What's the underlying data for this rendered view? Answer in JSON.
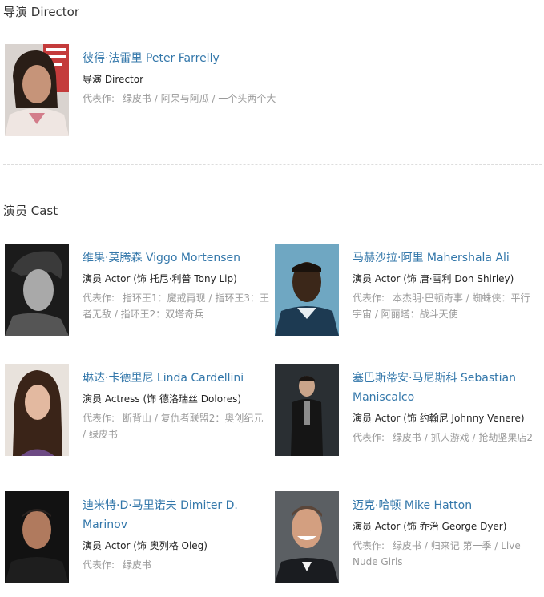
{
  "sections": {
    "director_title": "导演 Director",
    "cast_title": "演员 Cast"
  },
  "works_label": "代表作:",
  "director": {
    "name": "彼得·法雷里 Peter Farrelly",
    "role": "导演 Director",
    "works": "绿皮书 / 阿呆与阿瓜 / 一个头两个大"
  },
  "cast": [
    {
      "name": "维果·莫腾森 Viggo Mortensen",
      "role": "演员 Actor (饰 托尼·利普 Tony Lip)",
      "works": "指环王1：魔戒再现 / 指环王3：王者无敌 / 指环王2：双塔奇兵"
    },
    {
      "name": "马赫沙拉·阿里 Mahershala Ali",
      "role": "演员 Actor (饰 唐·雪利 Don Shirley)",
      "works": "本杰明·巴顿奇事 / 蜘蛛侠：平行宇宙 / 阿丽塔：战斗天使"
    },
    {
      "name": "琳达·卡德里尼 Linda Cardellini",
      "role": "演员 Actress (饰 德洛瑞丝 Dolores)",
      "works": "断背山 / 复仇者联盟2：奥创纪元 / 绿皮书"
    },
    {
      "name": "塞巴斯蒂安·马尼斯科 Sebastian Maniscalco",
      "role": "演员 Actor (饰 约翰尼 Johnny Venere)",
      "works": "绿皮书 / 抓人游戏 / 抢劫坚果店2"
    },
    {
      "name": "迪米特·D·马里诺夫 Dimiter D. Marinov",
      "role": "演员 Actor (饰 奥列格 Oleg)",
      "works": "绿皮书"
    },
    {
      "name": "迈克·哈顿 Mike Hatton",
      "role": "演员 Actor (饰 乔治 George Dyer)",
      "works": "绿皮书 / 归来记 第一季 / Live Nude Girls"
    }
  ]
}
